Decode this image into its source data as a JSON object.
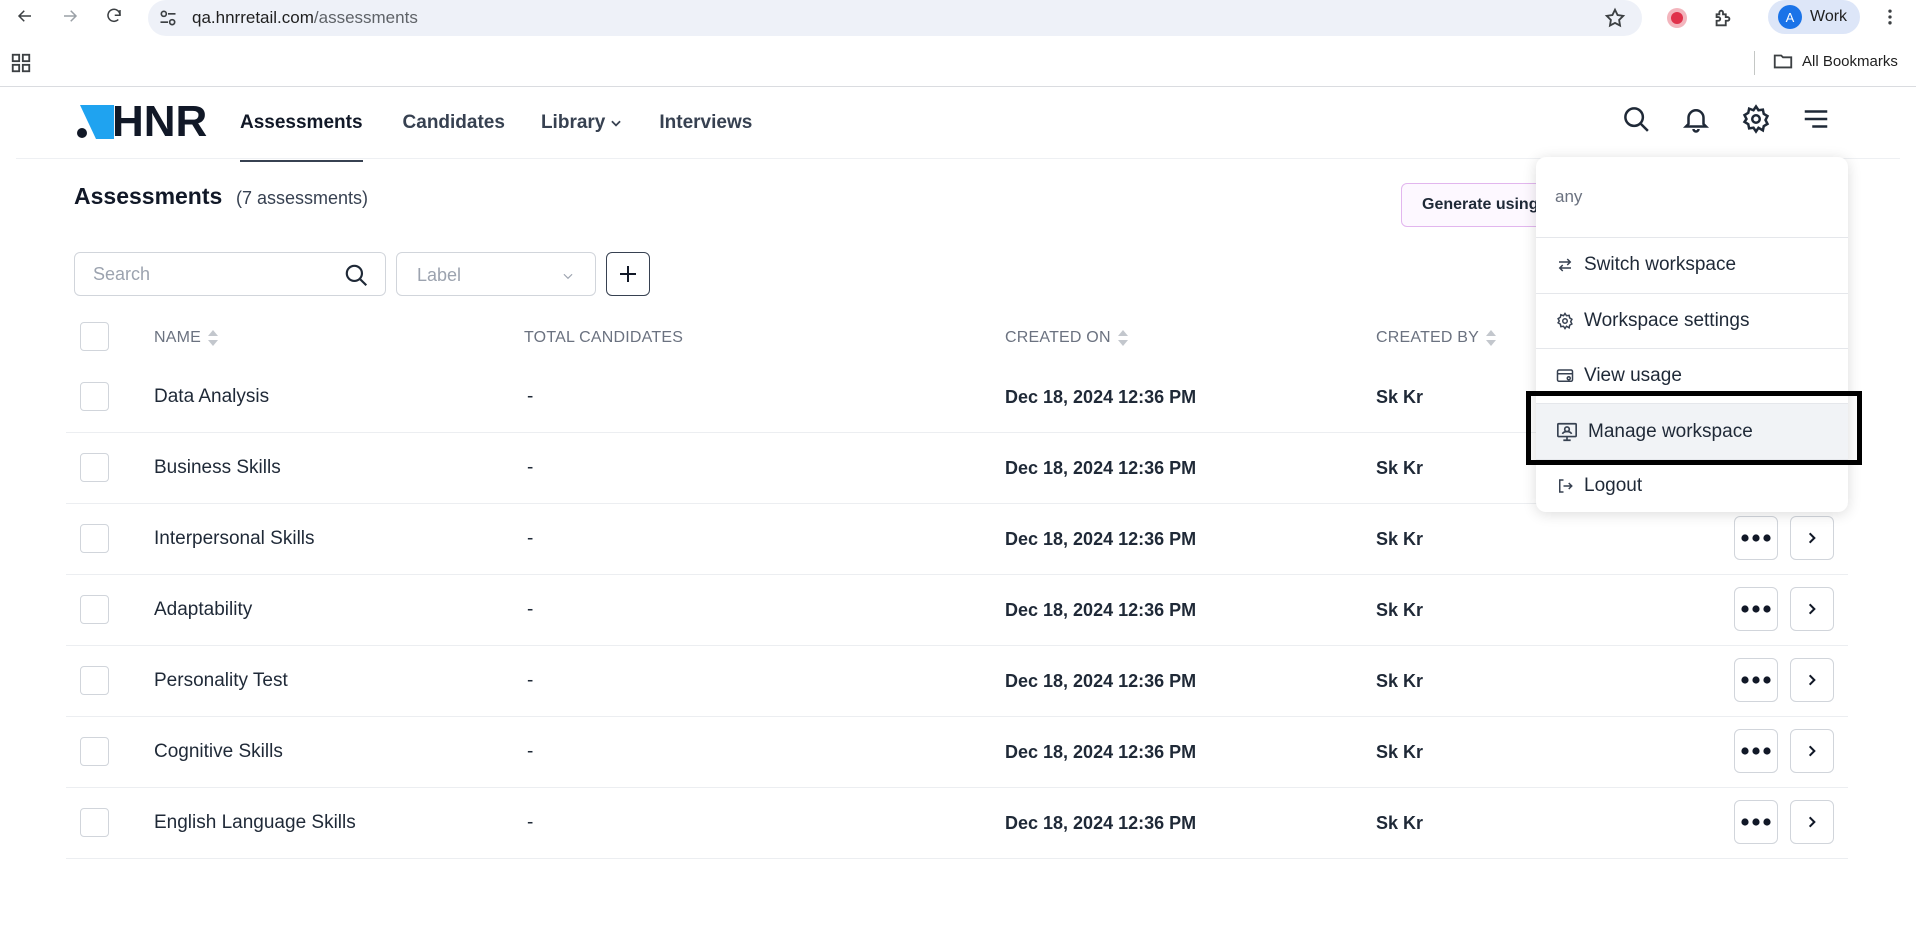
{
  "browser": {
    "url_host": "qa.hnrretail.com",
    "url_path": "/assessments",
    "profile_initial": "A",
    "profile_label": "Work",
    "bookmarks_label": "All Bookmarks"
  },
  "header": {
    "logo_text": "HNR",
    "nav": [
      {
        "label": "Assessments",
        "active": true
      },
      {
        "label": "Candidates",
        "active": false
      },
      {
        "label": "Library",
        "active": false
      },
      {
        "label": "Interviews",
        "active": false
      }
    ],
    "icons": [
      "search-icon",
      "bell-icon",
      "gear-icon",
      "menu-icon"
    ]
  },
  "page": {
    "title": "Assessments",
    "count": "(7 assessments)",
    "generate_button": "Generate using"
  },
  "filters": {
    "search_placeholder": "Search",
    "label_placeholder": "Label"
  },
  "table": {
    "columns": {
      "name": "NAME",
      "total_candidates": "TOTAL CANDIDATES",
      "created_on": "CREATED ON",
      "created_by": "CREATED BY"
    },
    "rows": [
      {
        "name": "Data Analysis",
        "total_candidates": "-",
        "created_on": "Dec 18, 2024 12:36 PM",
        "created_by": "Sk Kr"
      },
      {
        "name": "Business Skills",
        "total_candidates": "-",
        "created_on": "Dec 18, 2024 12:36 PM",
        "created_by": "Sk Kr"
      },
      {
        "name": "Interpersonal Skills",
        "total_candidates": "-",
        "created_on": "Dec 18, 2024 12:36 PM",
        "created_by": "Sk Kr"
      },
      {
        "name": "Adaptability",
        "total_candidates": "-",
        "created_on": "Dec 18, 2024 12:36 PM",
        "created_by": "Sk Kr"
      },
      {
        "name": "Personality Test",
        "total_candidates": "-",
        "created_on": "Dec 18, 2024 12:36 PM",
        "created_by": "Sk Kr"
      },
      {
        "name": "Cognitive Skills",
        "total_candidates": "-",
        "created_on": "Dec 18, 2024 12:36 PM",
        "created_by": "Sk Kr"
      },
      {
        "name": "English Language Skills",
        "total_candidates": "-",
        "created_on": "Dec 18, 2024 12:36 PM",
        "created_by": "Sk Kr"
      }
    ]
  },
  "menu": {
    "workspace_name": "any",
    "items": [
      {
        "label": "Switch workspace",
        "icon": "swap-icon"
      },
      {
        "label": "Workspace settings",
        "icon": "gear-icon"
      },
      {
        "label": "View usage",
        "icon": "usage-icon"
      },
      {
        "label": "Manage workspace",
        "icon": "manage-workspace-icon",
        "highlighted": true
      },
      {
        "label": "Logout",
        "icon": "logout-icon"
      }
    ]
  },
  "colors": {
    "highlight_border": "#000000",
    "generate_border": "#e2b6ee",
    "logo_accent": "#1fa3f0",
    "profile_chip": "#dde6f8"
  }
}
